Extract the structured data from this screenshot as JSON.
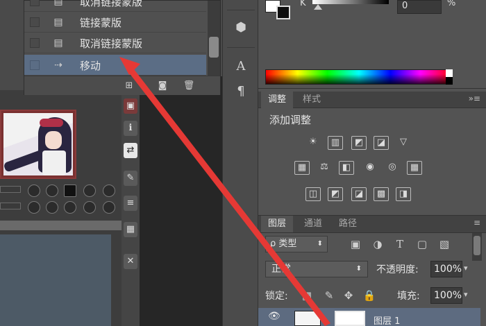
{
  "menu": {
    "items": [
      {
        "label": "取消链接蒙版",
        "icon": "folder-icon",
        "selected": false
      },
      {
        "label": "链接蒙版",
        "icon": "folder-icon",
        "selected": false
      },
      {
        "label": "取消链接蒙版",
        "icon": "folder-icon",
        "selected": false
      },
      {
        "label": "移动",
        "icon": "move-tool-icon",
        "selected": true
      }
    ],
    "footer_icons": [
      "new-action-icon",
      "camera-icon",
      "trash-icon"
    ]
  },
  "color_panel": {
    "channel_label": "K",
    "value": "0",
    "unit": "%"
  },
  "adjust_panel": {
    "tabs": [
      "调整",
      "样式"
    ],
    "title": "添加调整",
    "row1": [
      "☀",
      "▥",
      "◩",
      "◪",
      "▽"
    ],
    "row2": [
      "▦",
      "⚖",
      "◧",
      "◉",
      "◎",
      "▦"
    ],
    "row3": [
      "◫",
      "◩",
      "◪",
      "▩",
      "◨"
    ]
  },
  "layers_panel": {
    "tabs": [
      "图层",
      "通道",
      "路径"
    ],
    "filter_label": "ρ 类型",
    "blend_mode": "正常",
    "opacity_label": "不透明度:",
    "opacity_value": "100%",
    "lock_label": "锁定:",
    "fill_label": "填充:",
    "fill_value": "100%",
    "layer_name": "图层 1"
  },
  "colors": {
    "menu_selected": "#5b6d85",
    "arrow": "#e53935",
    "layer_selected": "#5d6b80"
  }
}
